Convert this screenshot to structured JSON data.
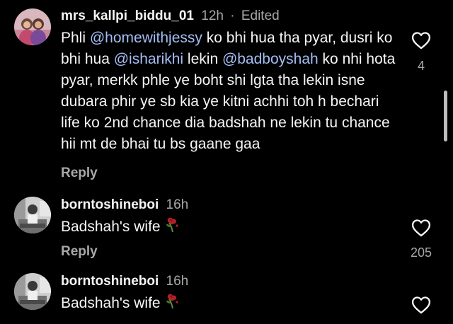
{
  "comments": [
    {
      "username": "mrs_kallpi_biddu_01",
      "time": "12h",
      "separator": "·",
      "edited": "Edited",
      "text_parts": [
        {
          "text": "Phli ",
          "mention": false
        },
        {
          "text": "@homewithjessy",
          "mention": true
        },
        {
          "text": " ko bhi hua tha pyar, dusri ko bhi hua ",
          "mention": false
        },
        {
          "text": "@isharikhi",
          "mention": true
        },
        {
          "text": " lekin ",
          "mention": false
        },
        {
          "text": "@badboyshah",
          "mention": true
        },
        {
          "text": " ko nhi hota pyar, merkk phle ye boht shi lgta tha lekin isne dubara phir ye sb kia ye kitni achhi toh h bechari life ko 2nd chance dia badshah ne lekin tu chance hii mt de bhai tu bs gaane gaa",
          "mention": false
        }
      ],
      "reply_label": "Reply",
      "like_count": "4",
      "like_icon": "heart-outline-icon"
    },
    {
      "username": "borntoshineboi",
      "time": "16h",
      "text": "Badshah's wife",
      "emoji": "wilted-rose",
      "reply_label": "Reply",
      "like_count": "205",
      "like_icon": "heart-outline-icon"
    },
    {
      "username": "borntoshineboi",
      "time": "16h",
      "text": "Badshah's wife",
      "emoji": "wilted-rose",
      "like_icon": "heart-outline-icon"
    }
  ],
  "colors": {
    "background": "#000000",
    "text": "#f5f5f5",
    "meta": "#a8a8a8",
    "mention": "#a4bef5"
  }
}
